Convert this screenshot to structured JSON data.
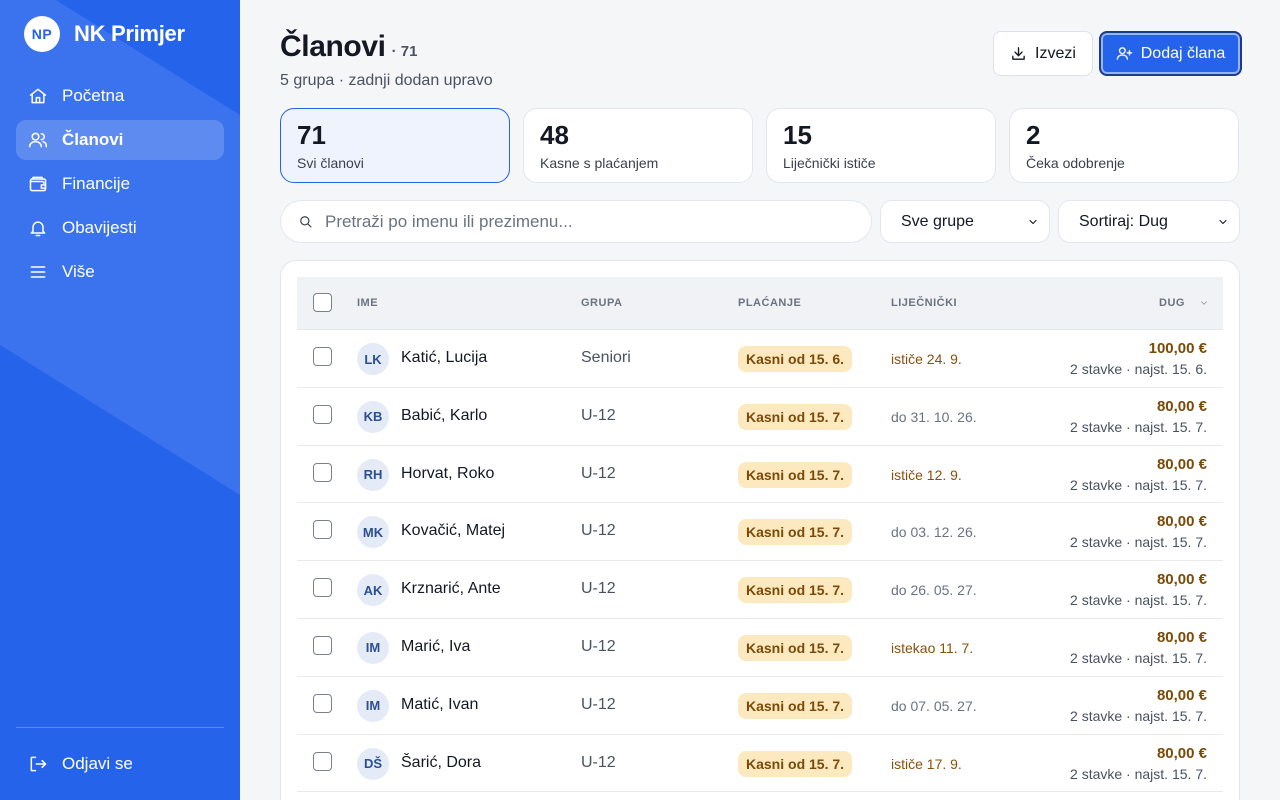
{
  "brand": {
    "initials": "NP",
    "name": "NK Primjer"
  },
  "sidebar": {
    "items": [
      {
        "label": "Početna",
        "icon": "home-icon"
      },
      {
        "label": "Članovi",
        "icon": "users-icon",
        "active": true
      },
      {
        "label": "Financije",
        "icon": "wallet-icon"
      },
      {
        "label": "Obavijesti",
        "icon": "bell-icon"
      },
      {
        "label": "Više",
        "icon": "menu-icon"
      }
    ],
    "logout": "Odjavi se"
  },
  "header": {
    "title": "Članovi",
    "count": "· 71",
    "subtitle": "5 grupa · zadnji dodan upravo",
    "export_label": "Izvezi",
    "add_label": "Dodaj člana"
  },
  "stats": [
    {
      "value": "71",
      "label": "Svi članovi",
      "active": true
    },
    {
      "value": "48",
      "label": "Kasne s plaćanjem"
    },
    {
      "value": "15",
      "label": "Liječnički ističe"
    },
    {
      "value": "2",
      "label": "Čeka odobrenje"
    }
  ],
  "filters": {
    "search_placeholder": "Pretraži po imenu ili prezimenu...",
    "group_select": "Sve grupe",
    "sort_select": "Sortiraj: Dug"
  },
  "table": {
    "columns": {
      "name": "IME",
      "group": "GRUPA",
      "payment": "PLAĆANJE",
      "medical": "LIJEČNIČKI",
      "debt": "DUG"
    },
    "rows": [
      {
        "initials": "LK",
        "name": "Katić, Lucija",
        "group": "Seniori",
        "payment": "Kasni od 15. 6.",
        "medical": "ističe 24. 9.",
        "medical_status": "warn",
        "amount": "100,00 €",
        "items": "2 stavke · najst. 15. 6."
      },
      {
        "initials": "KB",
        "name": "Babić, Karlo",
        "group": "U-12",
        "payment": "Kasni od 15. 7.",
        "medical": "do 31. 10. 26.",
        "medical_status": "ok",
        "amount": "80,00 €",
        "items": "2 stavke · najst. 15. 7."
      },
      {
        "initials": "RH",
        "name": "Horvat, Roko",
        "group": "U-12",
        "payment": "Kasni od 15. 7.",
        "medical": "ističe 12. 9.",
        "medical_status": "warn",
        "amount": "80,00 €",
        "items": "2 stavke · najst. 15. 7."
      },
      {
        "initials": "MK",
        "name": "Kovačić, Matej",
        "group": "U-12",
        "payment": "Kasni od 15. 7.",
        "medical": "do 03. 12. 26.",
        "medical_status": "ok",
        "amount": "80,00 €",
        "items": "2 stavke · najst. 15. 7."
      },
      {
        "initials": "AK",
        "name": "Krznarić, Ante",
        "group": "U-12",
        "payment": "Kasni od 15. 7.",
        "medical": "do 26. 05. 27.",
        "medical_status": "ok",
        "amount": "80,00 €",
        "items": "2 stavke · najst. 15. 7."
      },
      {
        "initials": "IM",
        "name": "Marić, Iva",
        "group": "U-12",
        "payment": "Kasni od 15. 7.",
        "medical": "istekao 11. 7.",
        "medical_status": "warn",
        "amount": "80,00 €",
        "items": "2 stavke · najst. 15. 7."
      },
      {
        "initials": "IM",
        "name": "Matić, Ivan",
        "group": "U-12",
        "payment": "Kasni od 15. 7.",
        "medical": "do 07. 05. 27.",
        "medical_status": "ok",
        "amount": "80,00 €",
        "items": "2 stavke · najst. 15. 7."
      },
      {
        "initials": "DŠ",
        "name": "Šarić, Dora",
        "group": "U-12",
        "payment": "Kasni od 15. 7.",
        "medical": "ističe 17. 9.",
        "medical_status": "warn",
        "amount": "80,00 €",
        "items": "2 stavke · najst. 15. 7."
      }
    ]
  },
  "colors": {
    "primary": "#2563eb",
    "badge_bg": "#fde9bf",
    "warn_text": "#8a4f0b"
  }
}
